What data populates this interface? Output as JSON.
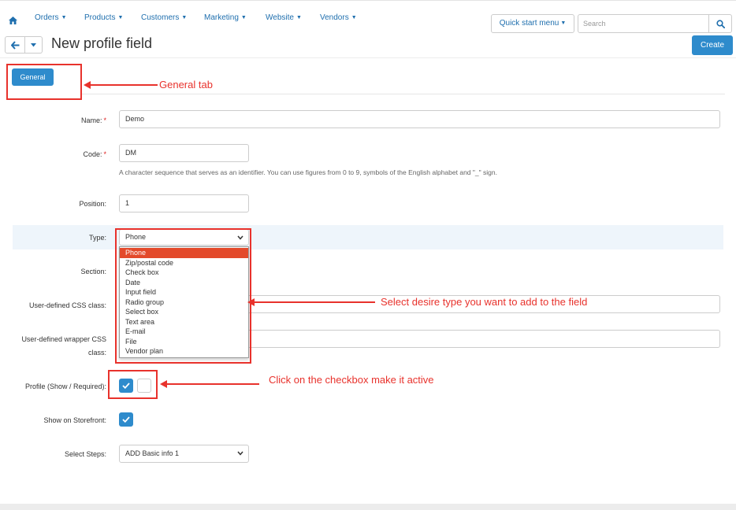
{
  "nav": {
    "items": [
      "Orders",
      "Products",
      "Customers",
      "Marketing",
      "Website",
      "Vendors"
    ],
    "quick_start": "Quick start menu",
    "search_placeholder": "Search"
  },
  "header": {
    "title": "New profile field",
    "create_label": "Create"
  },
  "tabs": {
    "general": "General"
  },
  "form": {
    "name_label": "Name:",
    "name_value": "Demo",
    "code_label": "Code:",
    "code_value": "DM",
    "code_help": "A character sequence that serves as an identifier. You can use figures from 0 to 9, symbols of the English alphabet and \"_\" sign.",
    "position_label": "Position:",
    "position_value": "1",
    "type_label": "Type:",
    "type_value": "Phone",
    "type_options": [
      "Phone",
      "Zip/postal code",
      "Check box",
      "Date",
      "Input field",
      "Radio group",
      "Select box",
      "Text area",
      "E-mail",
      "File",
      "Vendor plan"
    ],
    "section_label": "Section:",
    "css_class_label": "User-defined CSS class:",
    "wrapper_css_label_1": "User-defined wrapper CSS",
    "wrapper_css_label_2": "class:",
    "profile_label": "Profile (Show / Required):",
    "profile_show": true,
    "profile_required": false,
    "storefront_label": "Show on Storefront:",
    "storefront_checked": true,
    "steps_label": "Select Steps:",
    "steps_value": "ADD Basic info 1"
  },
  "annotations": {
    "general_tab": "General tab",
    "select_type": "Select desire type you want to add to the field",
    "checkbox": "Click on the checkbox make it active"
  },
  "colors": {
    "primary": "#2e8bcc",
    "link": "#1f6fae",
    "annotation": "#e8322c",
    "selected_option": "#e34a2b"
  },
  "icons": {
    "home": "home-icon",
    "search": "search-icon",
    "back": "arrow-left-icon",
    "dropdown": "caret-down-icon",
    "check": "check-icon"
  }
}
